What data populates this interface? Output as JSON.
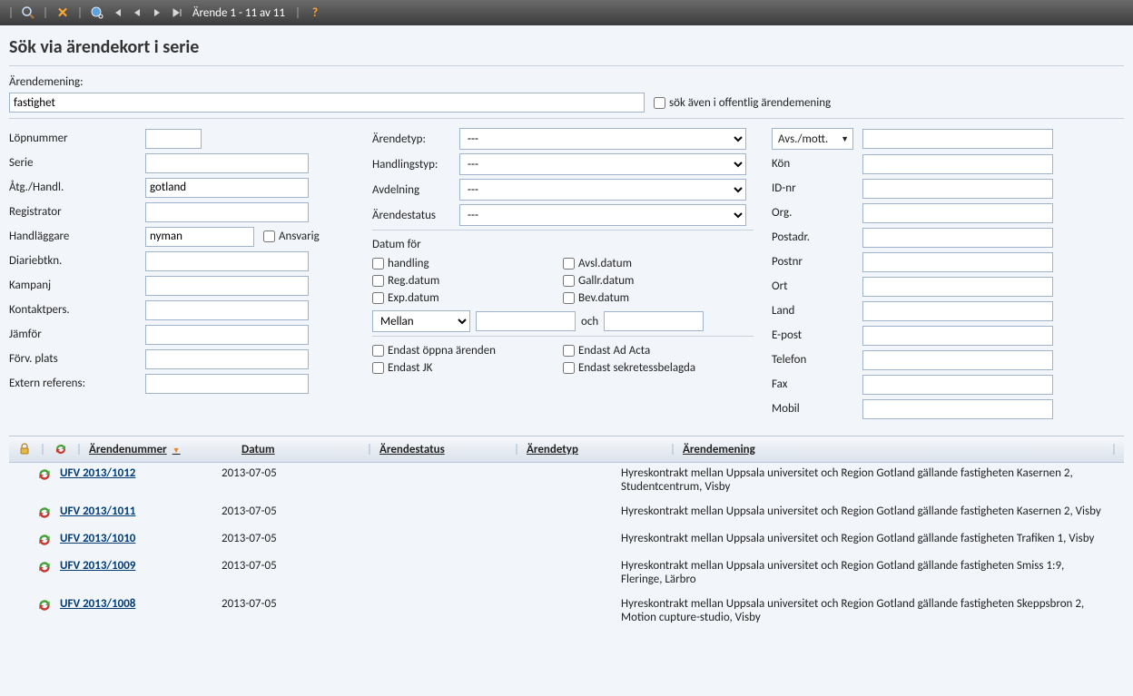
{
  "toolbar": {
    "pager_text": "Ärende 1 - 11 av 11",
    "help": "?"
  },
  "title": "Sök via ärendekort i serie",
  "search": {
    "label": "Ärendemening:",
    "value": "fastighet",
    "public_chk": "sök även i offentlig ärendemening"
  },
  "col1": {
    "lopnummer": "Löpnummer",
    "serie": "Serie",
    "atg": "Åtg./Handl.",
    "atg_val": "gotland",
    "registrator": "Registrator",
    "handlaggare": "Handläggare",
    "handlaggare_val": "nyman",
    "ansvarig": "Ansvarig",
    "diariebtkn": "Diariebtkn.",
    "kampanj": "Kampanj",
    "kontaktpers": "Kontaktpers.",
    "jamfor": "Jämför",
    "forv": "Förv. plats",
    "extern": "Extern referens:"
  },
  "col2": {
    "arendetyp": "Ärendetyp:",
    "handlingstyp": "Handlingstyp:",
    "avdelning": "Avdelning",
    "arendestatus": "Ärendestatus",
    "dash": "---",
    "datum_for": "Datum för",
    "d_handling": "handling",
    "d_reg": "Reg.datum",
    "d_exp": "Exp.datum",
    "d_avsl": "Avsl.datum",
    "d_gallr": "Gallr.datum",
    "d_bev": "Bev.datum",
    "mellan": "Mellan",
    "och": "och",
    "f_oppna": "Endast öppna ärenden",
    "f_adacta": "Endast Ad Acta",
    "f_jk": "Endast JK",
    "f_sekr": "Endast sekretessbelagda"
  },
  "col3": {
    "avsmott": "Avs./mott.",
    "kon": "Kön",
    "idnr": "ID-nr",
    "org": "Org.",
    "postadr": "Postadr.",
    "postnr": "Postnr",
    "ort": "Ort",
    "land": "Land",
    "epost": "E-post",
    "telefon": "Telefon",
    "fax": "Fax",
    "mobil": "Mobil"
  },
  "headers": {
    "arendenummer": "Ärendenummer",
    "datum": "Datum",
    "arendestatus": "Ärendestatus",
    "arendetyp": "Ärendetyp",
    "arendemening": "Ärendemening"
  },
  "rows": [
    {
      "num": "UFV 2013/1012",
      "date": "2013-07-05",
      "desc": "Hyreskontrakt mellan Uppsala universitet och Region Gotland gällande fastigheten Kasernen 2, Studentcentrum, Visby"
    },
    {
      "num": "UFV 2013/1011",
      "date": "2013-07-05",
      "desc": "Hyreskontrakt mellan Uppsala universitet och Region Gotland gällande fastigheten Kasernen 2, Visby"
    },
    {
      "num": "UFV 2013/1010",
      "date": "2013-07-05",
      "desc": "Hyreskontrakt mellan Uppsala universitet och Region Gotland gällande fastigheten Trafiken 1, Visby"
    },
    {
      "num": "UFV 2013/1009",
      "date": "2013-07-05",
      "desc": "Hyreskontrakt mellan Uppsala universitet och Region Gotland gällande fastigheten Smiss 1:9, Fleringe, Lärbro"
    },
    {
      "num": "UFV 2013/1008",
      "date": "2013-07-05",
      "desc": "Hyreskontrakt mellan Uppsala universitet och Region Gotland gällande fastigheten Skeppsbron 2, Motion cupture-studio, Visby"
    }
  ]
}
